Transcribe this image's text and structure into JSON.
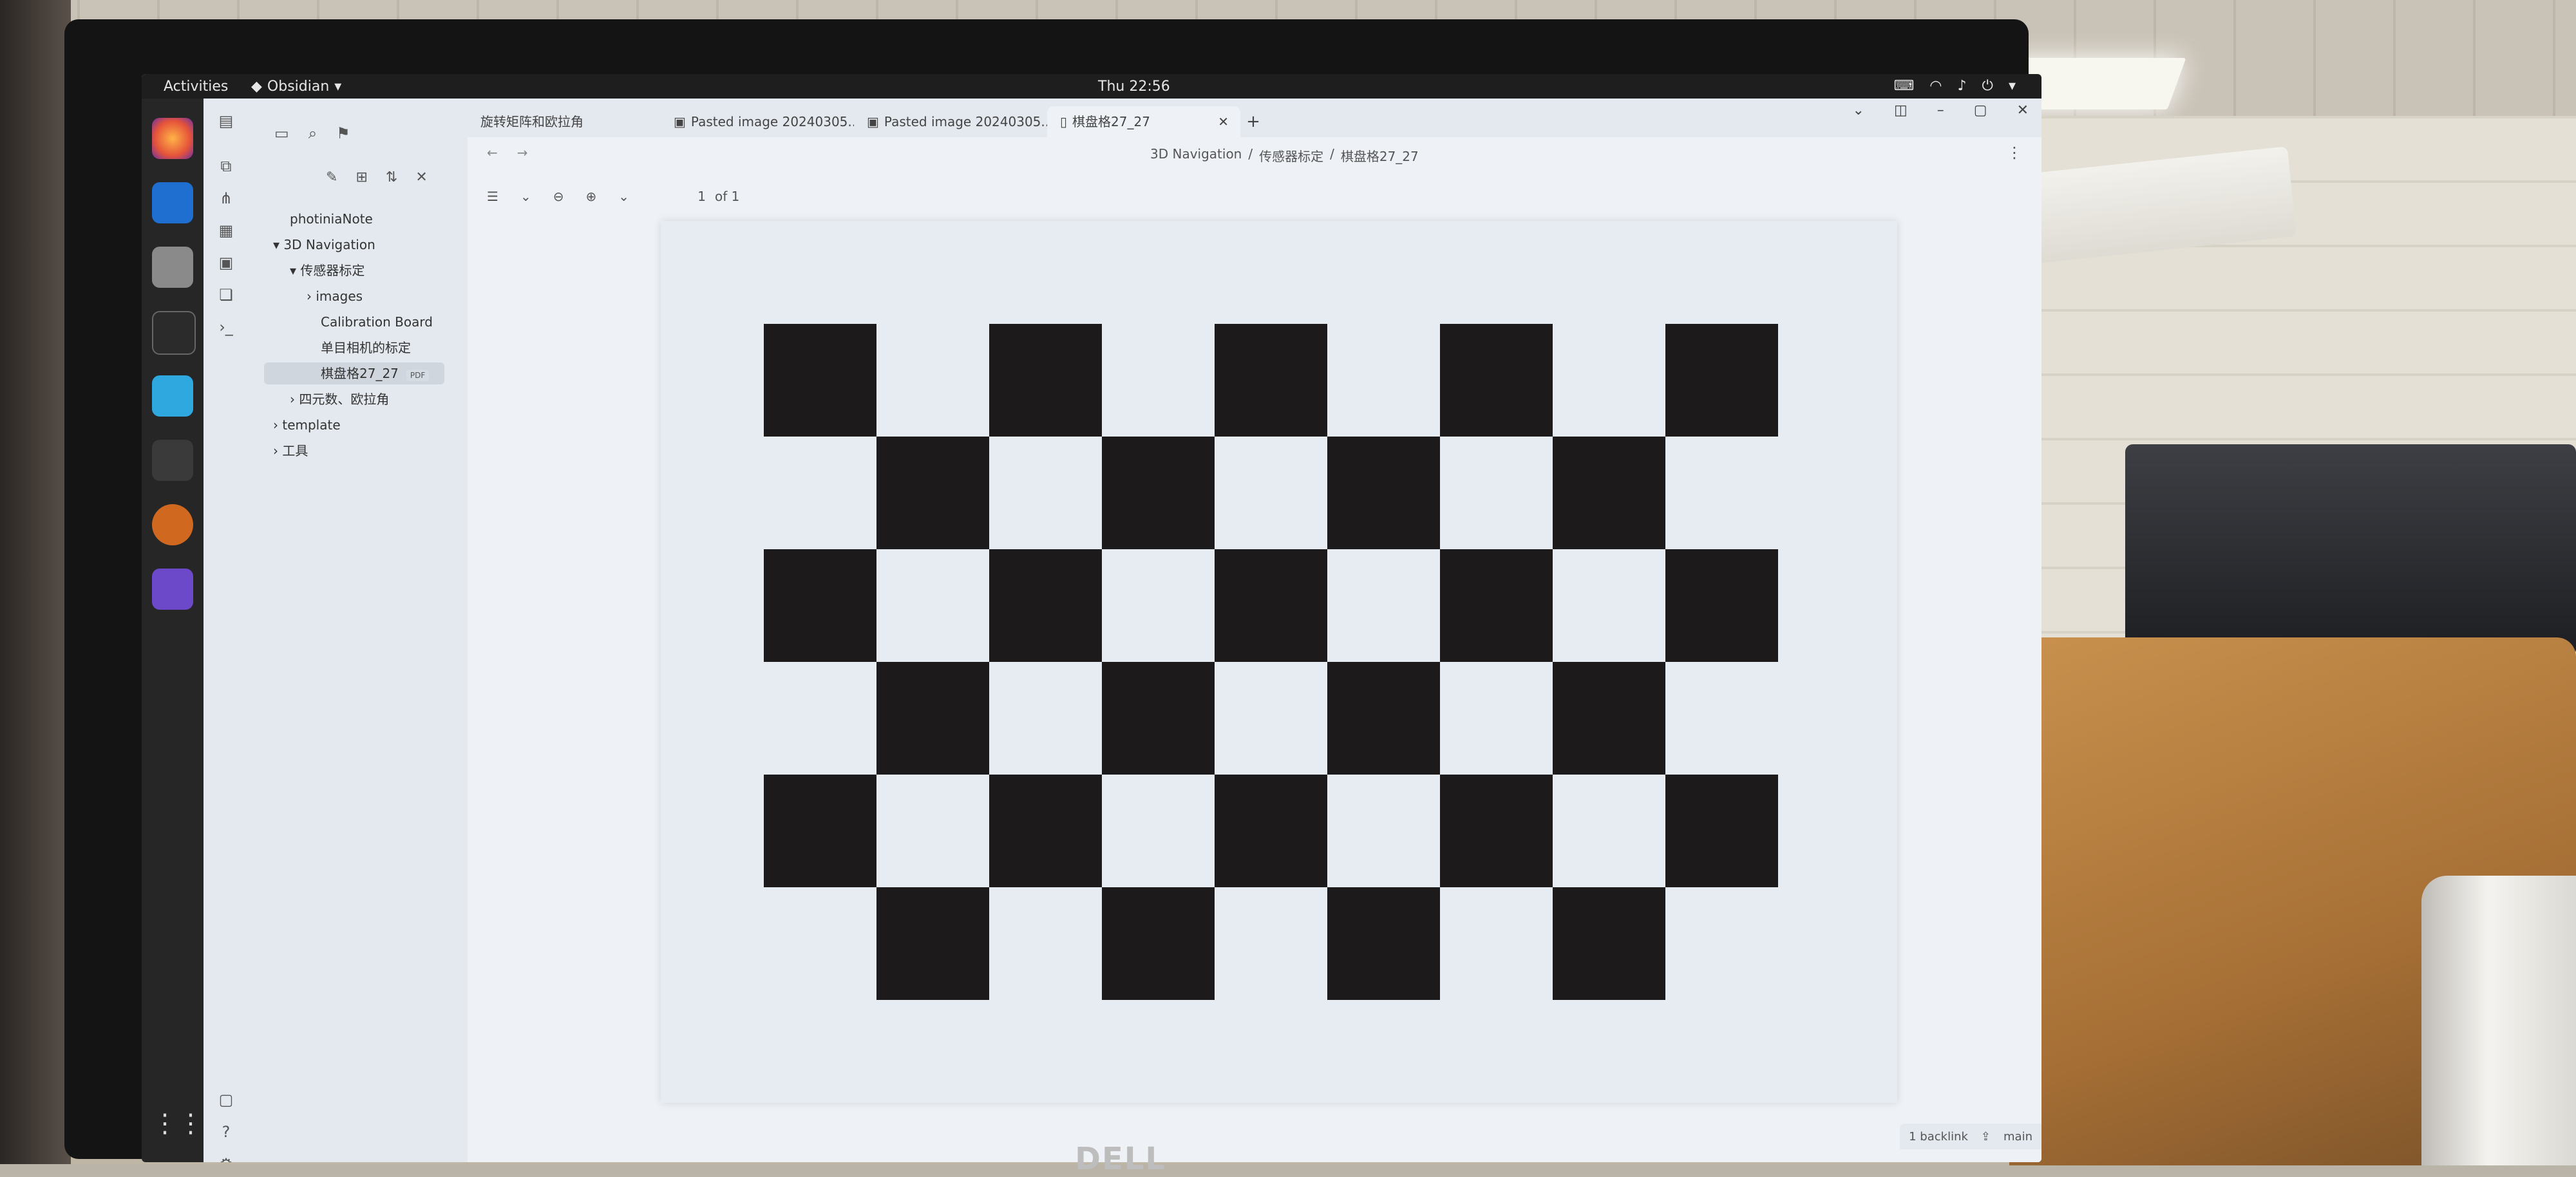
{
  "system": {
    "activities": "Activities",
    "app_name": "Obsidian",
    "clock": "Thu 22:56"
  },
  "sidebar": {
    "vault": "photiniaNote",
    "items": [
      {
        "label": "3D Navigation"
      },
      {
        "label": "传感器标定"
      },
      {
        "label": "images"
      },
      {
        "label": "Calibration Board"
      },
      {
        "label": "单目相机的标定"
      },
      {
        "label": "棋盘格27_27",
        "tag": "PDF"
      },
      {
        "label": "四元数、欧拉角"
      },
      {
        "label": "template"
      },
      {
        "label": "工具"
      }
    ]
  },
  "tabs": [
    {
      "label": "旋转矩阵和欧拉角"
    },
    {
      "label": "Pasted image 20240305..."
    },
    {
      "label": "Pasted image 20240305..."
    },
    {
      "label": "棋盘格27_27"
    }
  ],
  "breadcrumb": [
    "3D Navigation",
    "/",
    "传感器标定",
    "/",
    "棋盘格27_27"
  ],
  "pdf": {
    "page": "1",
    "of_label": "of 1"
  },
  "status": {
    "backlinks": "1 backlink",
    "branch": "main"
  },
  "monitor_brand": "DELL",
  "icons": [
    "firefox-icon",
    "vscode-icon",
    "files-icon",
    "terminal-icon",
    "app-icon",
    "obsidian-icon"
  ]
}
